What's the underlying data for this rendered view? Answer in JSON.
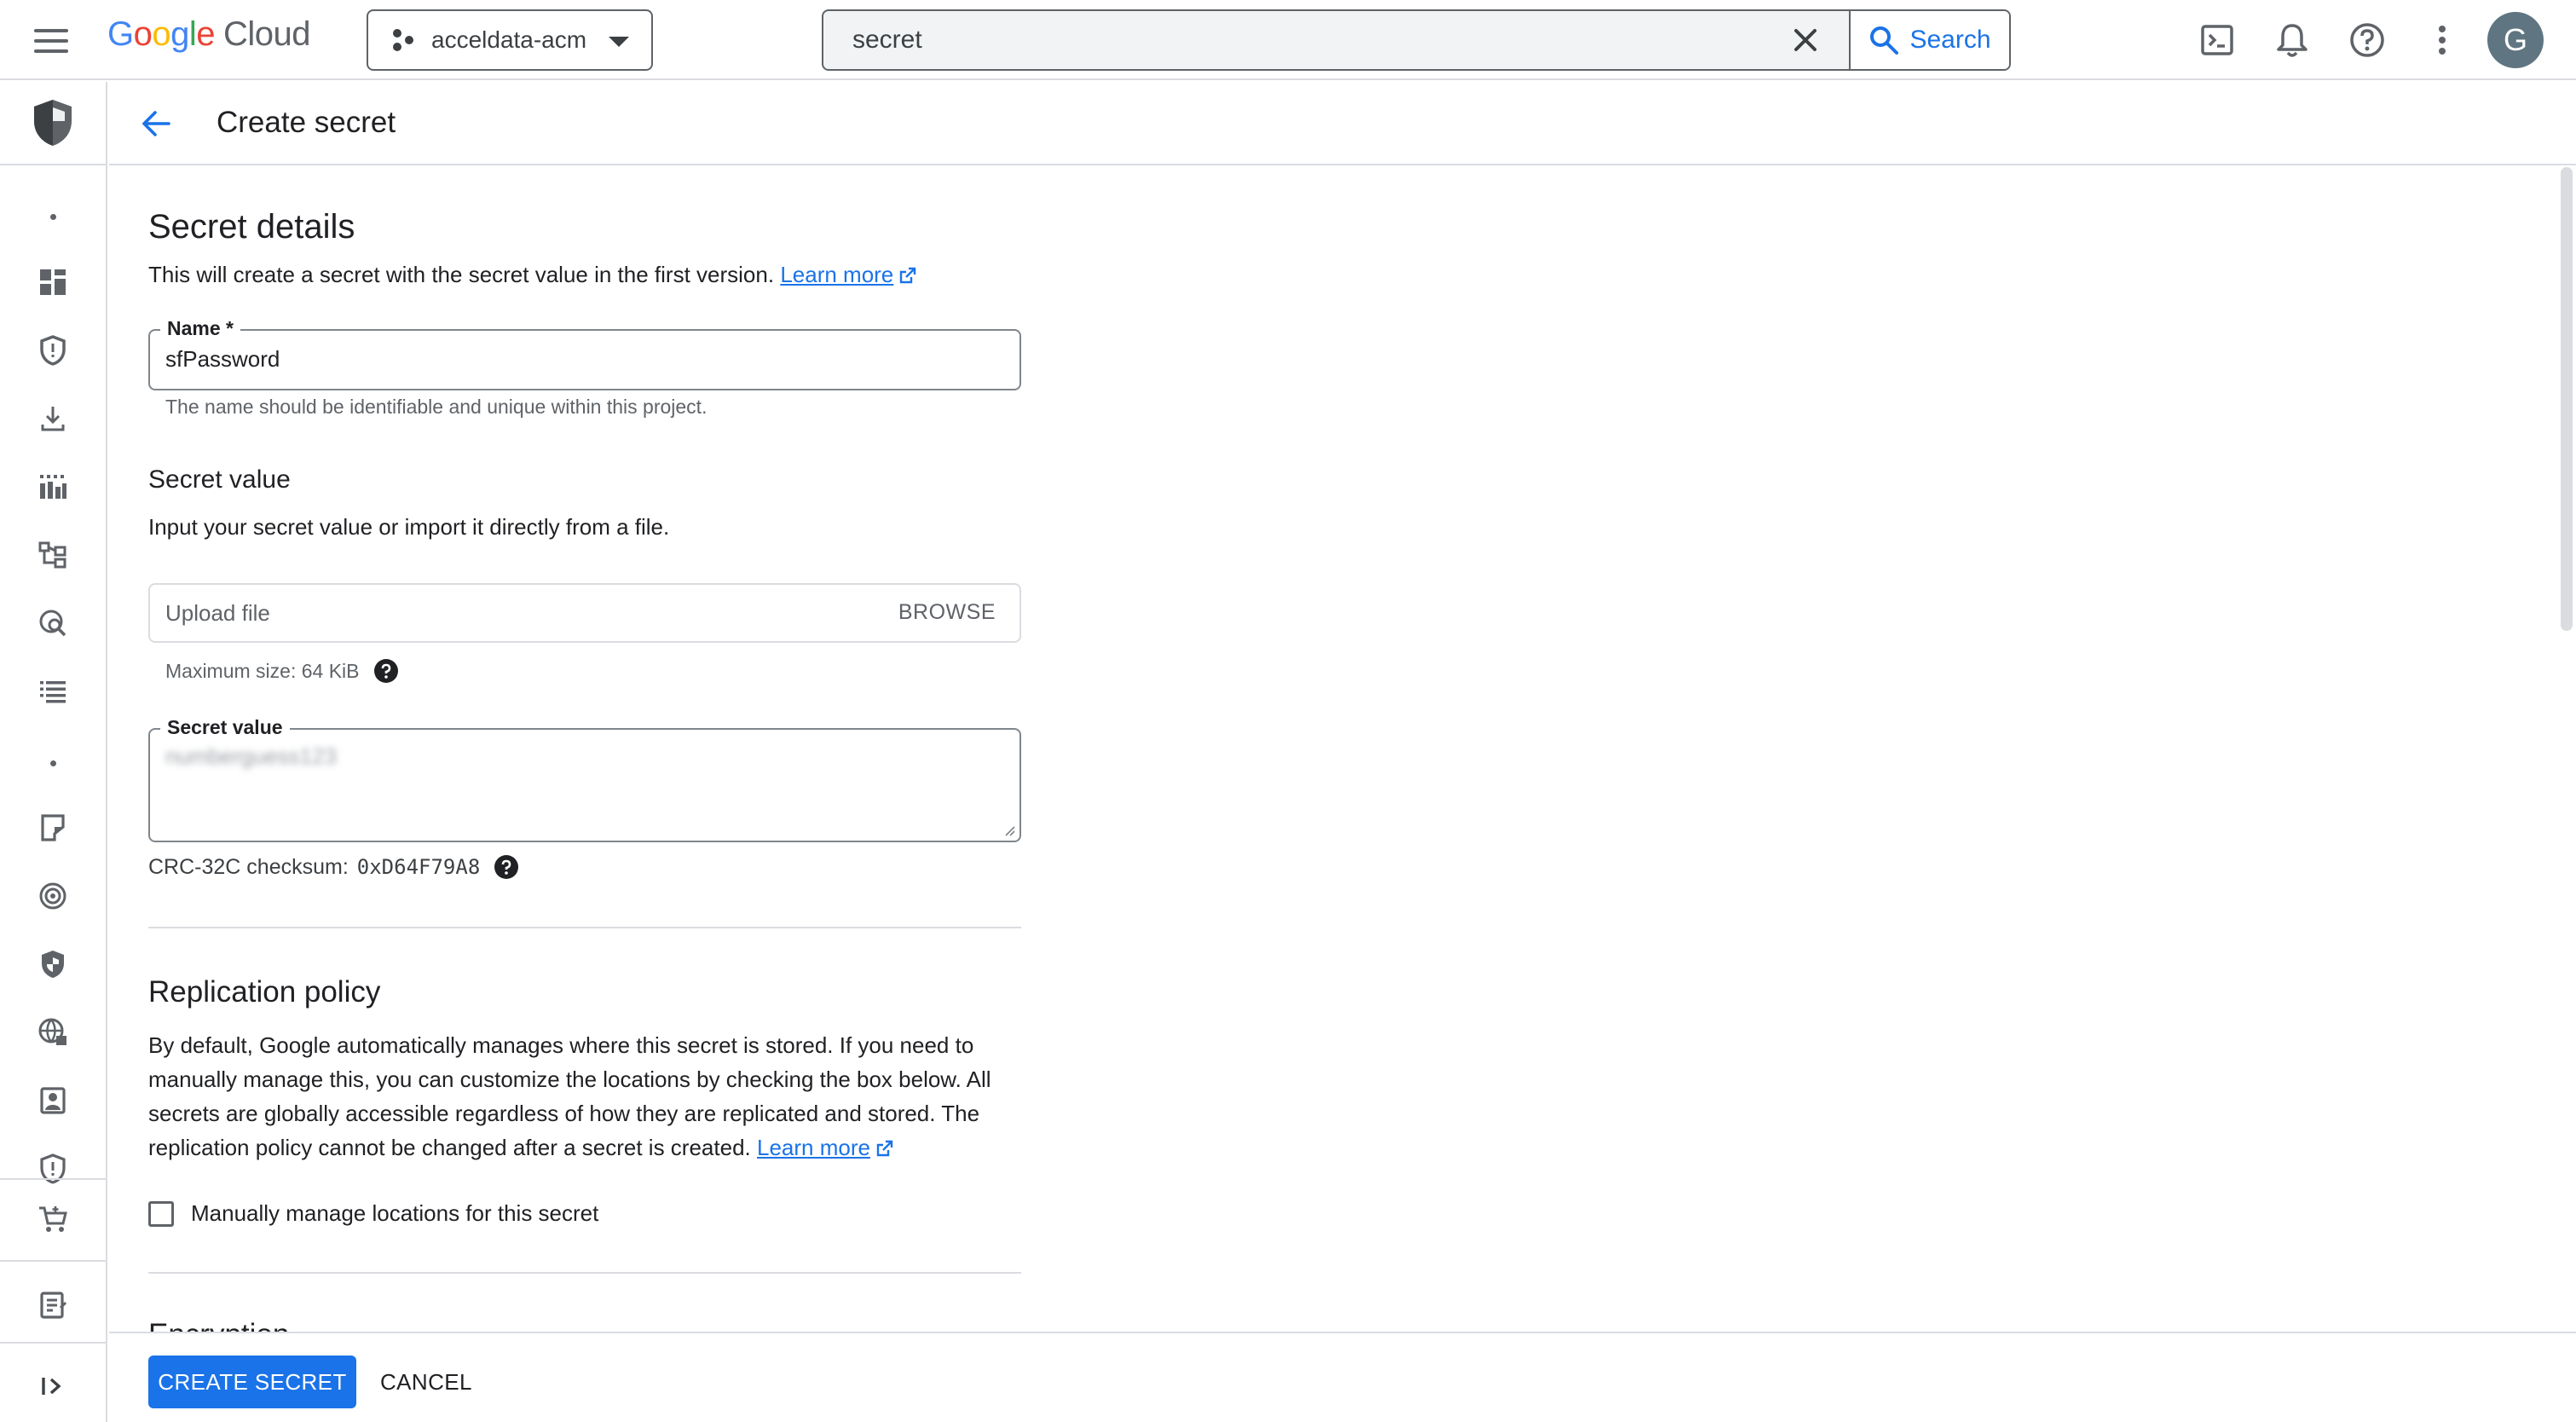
{
  "header": {
    "logo_parts": [
      "G",
      "o",
      "o",
      "g",
      "l",
      "e"
    ],
    "logo_suffix": "Cloud",
    "project_name": "acceldata-acm",
    "search_value": "secret",
    "search_button_label": "Search",
    "avatar_initial": "G"
  },
  "page": {
    "title": "Create secret"
  },
  "secret_details": {
    "heading": "Secret details",
    "description": "This will create a secret with the secret value in the first version.",
    "learn_more": "Learn more",
    "name_label": "Name *",
    "name_value": "sfPassword",
    "name_hint": "The name should be identifiable and unique within this project."
  },
  "secret_value": {
    "heading": "Secret value",
    "description": "Input your secret value or import it directly from a file.",
    "upload_placeholder": "Upload file",
    "browse_label": "BROWSE",
    "max_size": "Maximum size: 64 KiB",
    "field_label": "Secret value",
    "masked_value": "numberguess123",
    "checksum_label": "CRC-32C checksum:",
    "checksum_value": "0xD64F79A8"
  },
  "replication": {
    "heading": "Replication policy",
    "description": "By default, Google automatically manages where this secret is stored. If you need to manually manage this, you can customize the locations by checking the box below. All secrets are globally accessible regardless of how they are replicated and stored. The replication policy cannot be changed after a secret is created.",
    "learn_more": "Learn more",
    "checkbox_label": "Manually manage locations for this secret",
    "checkbox_checked": false
  },
  "encryption": {
    "heading": "Encryption"
  },
  "actions": {
    "create_label": "CREATE SECRET",
    "cancel_label": "CANCEL"
  },
  "colors": {
    "accent": "#1a73e8",
    "text": "#202124",
    "muted": "#5f6368",
    "border": "#dadce0"
  },
  "icons": {
    "rail": [
      "security-shield-icon",
      "dashboard-icon",
      "shield-outline-icon",
      "download-icon",
      "bar-chart-icon",
      "hierarchy-icon",
      "search-globe-icon",
      "list-icon",
      "certificate-icon",
      "target-icon",
      "shield-filled-icon",
      "globe-lock-icon",
      "badge-icon",
      "shield-alert-icon",
      "cart-icon",
      "notes-icon",
      "expand-icon"
    ]
  }
}
